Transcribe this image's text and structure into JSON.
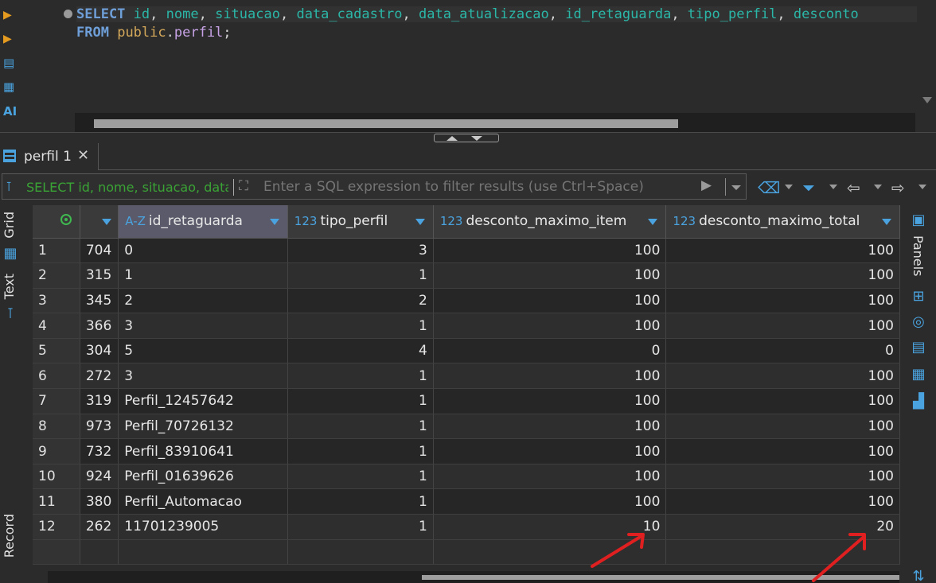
{
  "editor": {
    "line1_keyword": "SELECT",
    "line1_columns": [
      "id",
      "nome",
      "situacao",
      "data_cadastro",
      "data_atualizacao",
      "id_retaguarda",
      "tipo_perfil",
      "desconto"
    ],
    "line2_keyword": "FROM",
    "line2_schema": "public",
    "line2_table": "perfil",
    "line2_end": ";"
  },
  "left_toolbar": {
    "ai_label": "AI"
  },
  "result_tab": {
    "label": "perfil 1"
  },
  "filter": {
    "prefix": "SELECT id, nome, situacao, data",
    "placeholder": "Enter a SQL expression to filter results (use Ctrl+Space)"
  },
  "side_tabs": {
    "grid": "Grid",
    "text": "Text",
    "record": "Record"
  },
  "right_panel": {
    "label": "Panels"
  },
  "grid": {
    "columns": [
      {
        "type": "A-Z",
        "name": "id_retaguarda"
      },
      {
        "type": "123",
        "name": "tipo_perfil"
      },
      {
        "type": "123",
        "name": "desconto_maximo_item"
      },
      {
        "type": "123",
        "name": "desconto_maximo_total"
      }
    ],
    "rows": [
      {
        "n": "1",
        "id": "704",
        "id_retaguarda": "0",
        "tipo_perfil": "3",
        "desconto_maximo_item": "100",
        "desconto_maximo_total": "100"
      },
      {
        "n": "2",
        "id": "315",
        "id_retaguarda": "1",
        "tipo_perfil": "1",
        "desconto_maximo_item": "100",
        "desconto_maximo_total": "100"
      },
      {
        "n": "3",
        "id": "345",
        "id_retaguarda": "2",
        "tipo_perfil": "2",
        "desconto_maximo_item": "100",
        "desconto_maximo_total": "100"
      },
      {
        "n": "4",
        "id": "366",
        "id_retaguarda": "3",
        "tipo_perfil": "1",
        "desconto_maximo_item": "100",
        "desconto_maximo_total": "100"
      },
      {
        "n": "5",
        "id": "304",
        "id_retaguarda": "5",
        "tipo_perfil": "4",
        "desconto_maximo_item": "0",
        "desconto_maximo_total": "0"
      },
      {
        "n": "6",
        "id": "272",
        "id_retaguarda": "3",
        "tipo_perfil": "1",
        "desconto_maximo_item": "100",
        "desconto_maximo_total": "100"
      },
      {
        "n": "7",
        "id": "319",
        "id_retaguarda": "Perfil_12457642",
        "tipo_perfil": "1",
        "desconto_maximo_item": "100",
        "desconto_maximo_total": "100"
      },
      {
        "n": "8",
        "id": "973",
        "id_retaguarda": "Perfil_70726132",
        "tipo_perfil": "1",
        "desconto_maximo_item": "100",
        "desconto_maximo_total": "100"
      },
      {
        "n": "9",
        "id": "732",
        "id_retaguarda": "Perfil_83910641",
        "tipo_perfil": "1",
        "desconto_maximo_item": "100",
        "desconto_maximo_total": "100"
      },
      {
        "n": "10",
        "id": "924",
        "id_retaguarda": "Perfil_01639626",
        "tipo_perfil": "1",
        "desconto_maximo_item": "100",
        "desconto_maximo_total": "100"
      },
      {
        "n": "11",
        "id": "380",
        "id_retaguarda": "Perfil_Automacao",
        "tipo_perfil": "1",
        "desconto_maximo_item": "100",
        "desconto_maximo_total": "100"
      },
      {
        "n": "12",
        "id": "262",
        "id_retaguarda": "11701239005",
        "tipo_perfil": "1",
        "desconto_maximo_item": "10",
        "desconto_maximo_total": "20"
      }
    ]
  },
  "colors": {
    "accent": "#4aa3df",
    "annotation": "#e02020",
    "filter_prefix": "#3aa335"
  }
}
